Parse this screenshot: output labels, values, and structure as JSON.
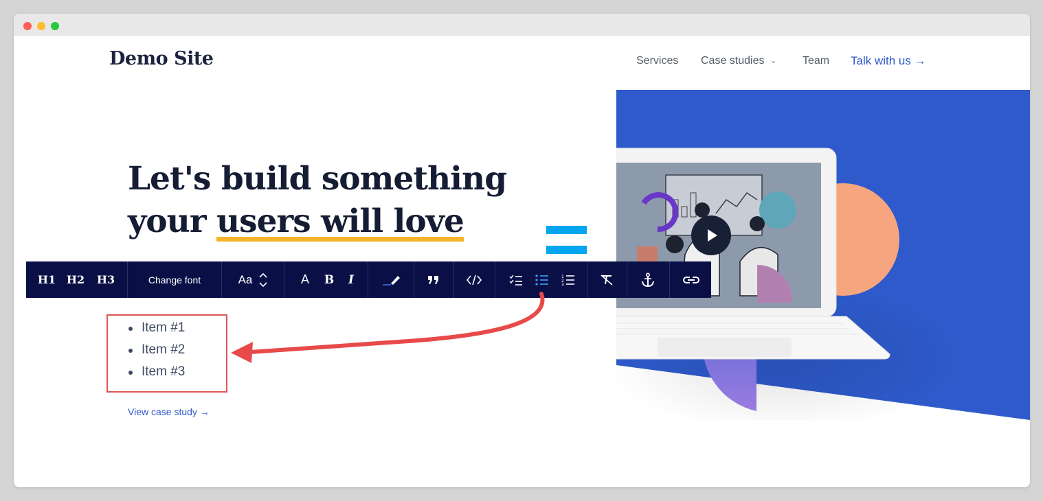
{
  "site": {
    "logo": "Demo Site"
  },
  "nav": {
    "services": "Services",
    "case_studies": "Case studies",
    "team": "Team",
    "cta": "Talk with us"
  },
  "hero": {
    "line1": "Let's build something",
    "line2_plain": "your ",
    "line2_highlight": "users will love"
  },
  "toolbar": {
    "h1": "H1",
    "h2": "H2",
    "h3": "H3",
    "change_font": "Change font",
    "font_size": "Aa",
    "text_color": "A",
    "bold": "B",
    "italic": "I",
    "active_tool": "bulleted-list",
    "icons": [
      "heading-1",
      "heading-2",
      "heading-3",
      "change-font",
      "font-size",
      "text-color",
      "bold",
      "italic",
      "highlight",
      "quote",
      "code",
      "checklist",
      "bulleted-list",
      "numbered-list",
      "clear-format",
      "anchor",
      "link"
    ]
  },
  "list": {
    "items": [
      "Item #1",
      "Item #2",
      "Item #3"
    ]
  },
  "view_case_study": "View case study",
  "colors": {
    "accent_blue": "#2e5acb",
    "toolbar_bg": "#0a1046",
    "highlight": "#f5b52a",
    "annotation_red": "#e84a4a"
  }
}
